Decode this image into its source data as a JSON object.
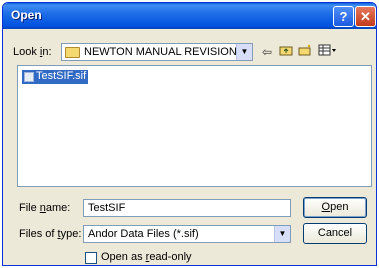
{
  "window": {
    "title": "Open"
  },
  "titlebar": {
    "help_glyph": "?",
    "close_glyph": "✕"
  },
  "lookin": {
    "label_prefix": "Look ",
    "label_key": "i",
    "label_suffix": "n:",
    "value": "NEWTON MANUAL REVISION"
  },
  "toolbar": {
    "icons": [
      "back-icon",
      "up-folder-icon",
      "new-folder-icon",
      "views-menu-icon"
    ]
  },
  "filelist": {
    "items": [
      {
        "name": "TestSIF.sif",
        "selected": true
      }
    ]
  },
  "filename": {
    "label_prefix": "File ",
    "label_key": "n",
    "label_suffix": "ame:",
    "value": "TestSIF"
  },
  "filetype": {
    "label_prefix": "Files of ",
    "label_key": "t",
    "label_suffix": "ype:",
    "value": "Andor Data Files  (*.sif)"
  },
  "buttons": {
    "open_key": "O",
    "open_rest": "pen",
    "cancel": "Cancel"
  },
  "readonly": {
    "label_prefix": "Open as ",
    "label_key": "r",
    "label_suffix": "ead-only",
    "checked": false
  },
  "colors": {
    "titlebar": "#0053e1",
    "selection": "#316ac5",
    "dialog": "#ece9d8"
  }
}
